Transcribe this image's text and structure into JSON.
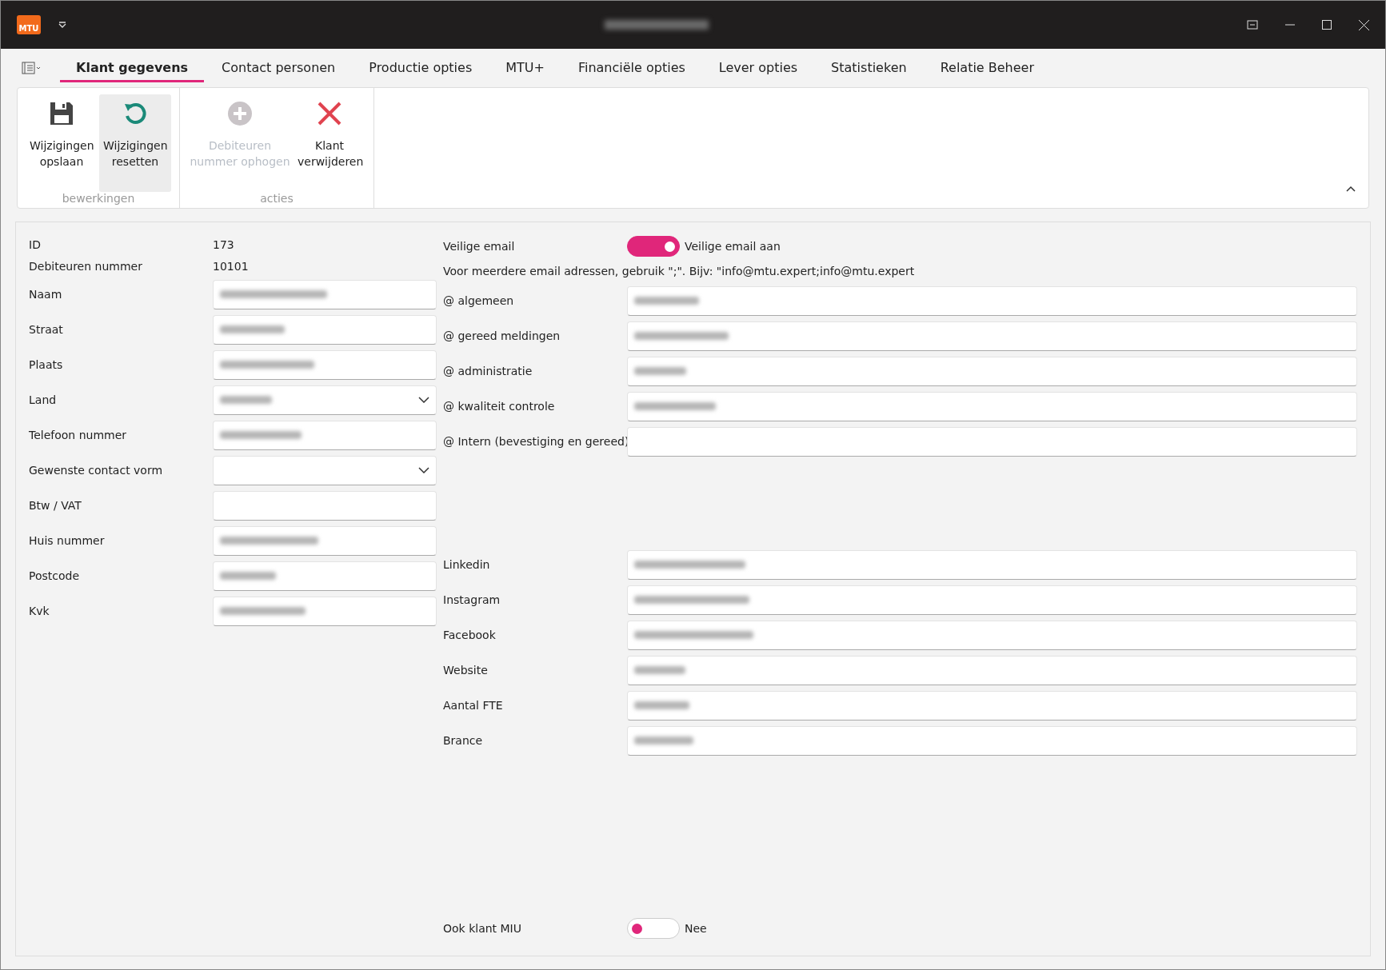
{
  "window": {
    "logo": "MTU",
    "title_blurred": true
  },
  "tabs": [
    {
      "label": "Klant gegevens",
      "selected": true
    },
    {
      "label": "Contact personen",
      "selected": false
    },
    {
      "label": "Productie opties",
      "selected": false
    },
    {
      "label": "MTU+",
      "selected": false
    },
    {
      "label": "Financiële opties",
      "selected": false
    },
    {
      "label": "Lever opties",
      "selected": false
    },
    {
      "label": "Statistieken",
      "selected": false
    },
    {
      "label": "Relatie Beheer",
      "selected": false
    }
  ],
  "ribbon": [
    {
      "label": "bewerkingen",
      "buttons": [
        {
          "kind": "save",
          "label": "Wijzigingen opslaan",
          "disabled": false,
          "hovered": false
        },
        {
          "kind": "reset",
          "label": "Wijzigingen resetten",
          "disabled": false,
          "hovered": true
        }
      ]
    },
    {
      "label": "acties",
      "buttons": [
        {
          "kind": "add",
          "label": "Debiteuren nummer ophogen",
          "disabled": true,
          "hovered": false
        },
        {
          "kind": "delete",
          "label": "Klant verwijderen",
          "disabled": false,
          "hovered": false
        }
      ]
    }
  ],
  "left_fields": [
    {
      "kind": "text",
      "label": "ID",
      "value": "173"
    },
    {
      "kind": "text",
      "label": "Debiteuren nummer",
      "value": "10101"
    },
    {
      "kind": "input",
      "label": "Naam",
      "blurred": true
    },
    {
      "kind": "input",
      "label": "Straat",
      "blurred": true
    },
    {
      "kind": "input",
      "label": "Plaats",
      "blurred": true
    },
    {
      "kind": "select",
      "label": "Land",
      "blurred": true
    },
    {
      "kind": "input",
      "label": "Telefoon nummer",
      "blurred": true
    },
    {
      "kind": "select",
      "label": "Gewenste contact vorm",
      "blurred": false
    },
    {
      "kind": "input",
      "label": "Btw / VAT",
      "blurred": false
    },
    {
      "kind": "input",
      "label": "Huis nummer",
      "blurred": true
    },
    {
      "kind": "input",
      "label": "Postcode",
      "blurred": true
    },
    {
      "kind": "input",
      "label": "Kvk",
      "blurred": true
    }
  ],
  "secure_email": {
    "label": "Veilige email",
    "on": true,
    "state_label": "Veilige email aan"
  },
  "email_hint": "Voor meerdere email adressen, gebruik \";\". Bijv: \"info@mtu.expert;info@mtu.expert",
  "email_fields": [
    {
      "label": "@ algemeen",
      "blurred": true
    },
    {
      "label": "@ gereed meldingen",
      "blurred": true
    },
    {
      "label": "@ administratie",
      "blurred": true
    },
    {
      "label": "@ kwaliteit controle",
      "blurred": true
    },
    {
      "label": "@ Intern (bevestiging en gereed)",
      "blurred": false
    }
  ],
  "other_fields": [
    {
      "label": "Linkedin",
      "blurred": true
    },
    {
      "label": "Instagram",
      "blurred": true
    },
    {
      "label": "Facebook",
      "blurred": true
    },
    {
      "label": "Website",
      "blurred": true
    },
    {
      "label": "Aantal FTE",
      "blurred": true
    },
    {
      "label": "Brance",
      "blurred": true
    }
  ],
  "miu": {
    "label": "Ook klant MIU",
    "on": false,
    "state_label": "Nee"
  }
}
